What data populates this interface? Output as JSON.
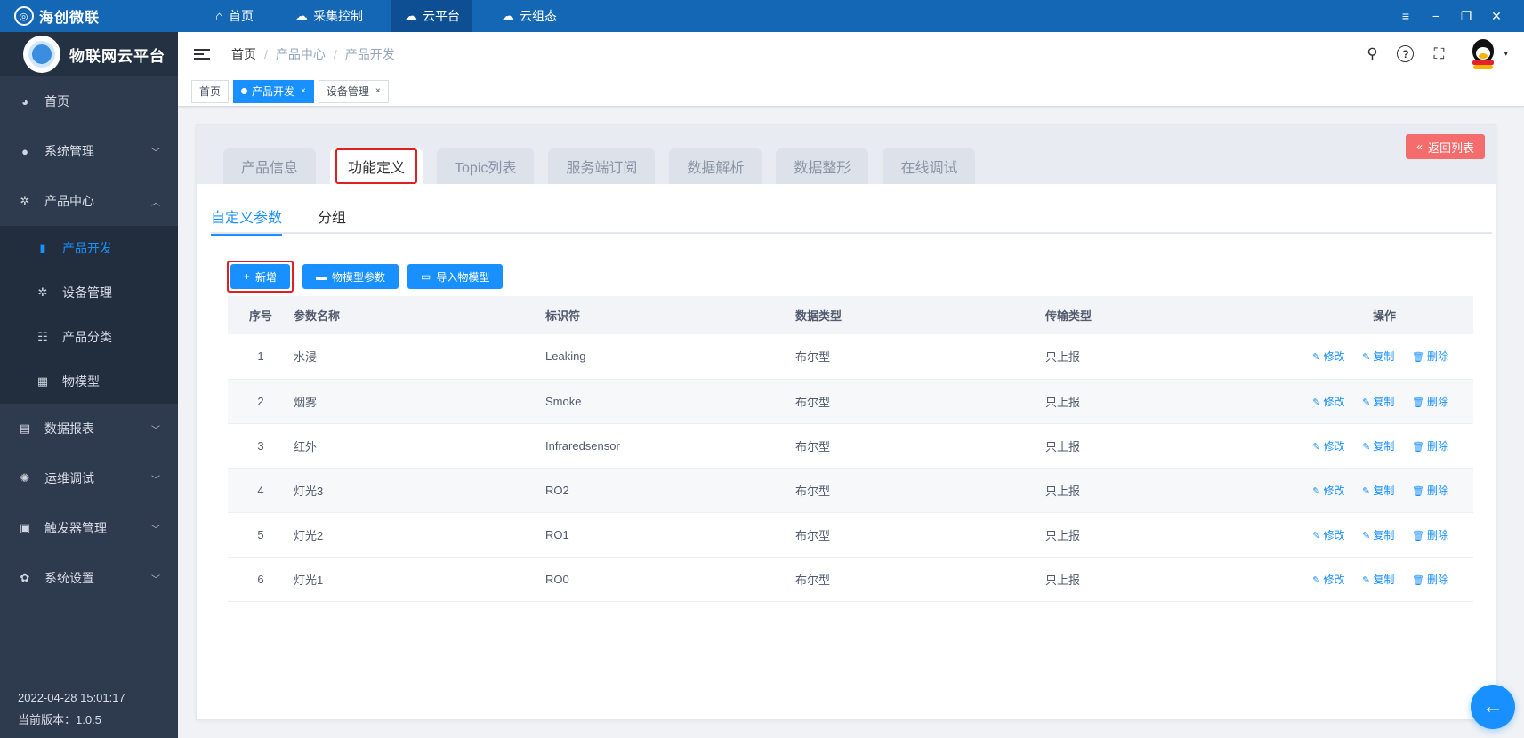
{
  "topbar": {
    "brand": "海创微联",
    "nav": [
      {
        "icon": "⌂",
        "label": "首页"
      },
      {
        "icon": "☁",
        "label": "采集控制"
      },
      {
        "icon": "☁",
        "label": "云平台"
      },
      {
        "icon": "☁",
        "label": "云组态"
      }
    ],
    "window_controls": {
      "menu": "≡",
      "minimize": "−",
      "restore": "❐",
      "close": "✕"
    }
  },
  "sidebar": {
    "title": "物联网云平台",
    "items": [
      {
        "label": "首页",
        "icon": "◕",
        "chevron": ""
      },
      {
        "label": "系统管理",
        "icon": "●",
        "chevron": "﹀"
      },
      {
        "label": "产品中心",
        "icon": "✲",
        "chevron": "︿"
      },
      {
        "label": "数据报表",
        "icon": "▤",
        "chevron": "﹀"
      },
      {
        "label": "运维调试",
        "icon": "✺",
        "chevron": "﹀"
      },
      {
        "label": "触发器管理",
        "icon": "▣",
        "chevron": "﹀"
      },
      {
        "label": "系统设置",
        "icon": "✿",
        "chevron": "﹀"
      }
    ],
    "submenu": [
      {
        "label": "产品开发",
        "icon": "▮"
      },
      {
        "label": "设备管理",
        "icon": "✲"
      },
      {
        "label": "产品分类",
        "icon": "☷"
      },
      {
        "label": "物模型",
        "icon": "▦"
      }
    ],
    "footer": {
      "datetime": "2022-04-28 15:01:17",
      "version": "当前版本：1.0.5"
    }
  },
  "header": {
    "breadcrumb": [
      "首页",
      "产品中心",
      "产品开发"
    ],
    "separator": "/",
    "icons": {
      "search": "⚲",
      "help": "?",
      "fullscreen": "⛶",
      "caret": "▾"
    }
  },
  "tags": [
    {
      "label": "首页",
      "close": ""
    },
    {
      "label": "产品开发",
      "close": "×"
    },
    {
      "label": "设备管理",
      "close": "×"
    }
  ],
  "card": {
    "tabs": [
      "产品信息",
      "功能定义",
      "Topic列表",
      "服务端订阅",
      "数据解析",
      "数据整形",
      "在线调试"
    ],
    "back_button": {
      "icon": "«",
      "label": "返回列表"
    },
    "subtabs": [
      "自定义参数",
      "分组"
    ],
    "toolbar": [
      {
        "icon": "+",
        "label": "新增"
      },
      {
        "icon": "▬",
        "label": "物模型参数"
      },
      {
        "icon": "▭",
        "label": "导入物模型"
      }
    ],
    "table": {
      "headers": [
        "序号",
        "参数名称",
        "标识符",
        "数据类型",
        "传输类型",
        "操作"
      ],
      "rows": [
        {
          "idx": "1",
          "name": "水浸",
          "identifier": "Leaking",
          "data_type": "布尔型",
          "transfer": "只上报"
        },
        {
          "idx": "2",
          "name": "烟雾",
          "identifier": "Smoke",
          "data_type": "布尔型",
          "transfer": "只上报"
        },
        {
          "idx": "3",
          "name": "红外",
          "identifier": "Infraredsensor",
          "data_type": "布尔型",
          "transfer": "只上报"
        },
        {
          "idx": "4",
          "name": "灯光3",
          "identifier": "RO2",
          "data_type": "布尔型",
          "transfer": "只上报"
        },
        {
          "idx": "5",
          "name": "灯光2",
          "identifier": "RO1",
          "data_type": "布尔型",
          "transfer": "只上报"
        },
        {
          "idx": "6",
          "name": "灯光1",
          "identifier": "RO0",
          "data_type": "布尔型",
          "transfer": "只上报"
        }
      ],
      "actions": [
        {
          "icon": "✎",
          "label": "修改"
        },
        {
          "icon": "✎",
          "label": "复制"
        },
        {
          "icon": "🗑",
          "label": "删除"
        }
      ]
    },
    "float_button": "←"
  },
  "colors": {
    "primary": "#1890ff",
    "topbar": "#1467b5",
    "sidebar": "#2e3b4e",
    "danger": "#f56c6c"
  }
}
